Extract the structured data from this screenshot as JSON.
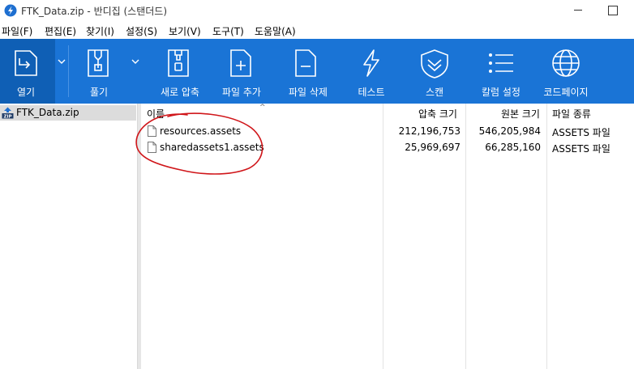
{
  "window": {
    "title": "FTK_Data.zip - 반디집 (스탠더드)"
  },
  "menu": [
    {
      "label": "파일(F)"
    },
    {
      "label": "편집(E)"
    },
    {
      "label": "찾기(I)"
    },
    {
      "label": "설정(S)"
    },
    {
      "label": "보기(V)"
    },
    {
      "label": "도구(T)"
    },
    {
      "label": "도움말(A)"
    }
  ],
  "toolbar": {
    "items": [
      {
        "label": "열기",
        "icon": "open-icon"
      },
      {
        "label": "풀기",
        "icon": "extract-icon"
      },
      {
        "label": "새로 압축",
        "icon": "new-archive-icon"
      },
      {
        "label": "파일 추가",
        "icon": "add-file-icon"
      },
      {
        "label": "파일 삭제",
        "icon": "delete-file-icon"
      },
      {
        "label": "테스트",
        "icon": "test-icon"
      },
      {
        "label": "스캔",
        "icon": "scan-icon"
      },
      {
        "label": "칼럼 설정",
        "icon": "column-settings-icon"
      },
      {
        "label": "코드페이지",
        "icon": "codepage-icon"
      }
    ],
    "colors": {
      "background": "#1a74d6",
      "selected": "#0f5fb5"
    }
  },
  "tree": {
    "root": "FTK_Data.zip"
  },
  "columns": {
    "name": "이름",
    "packed": "압축 크기",
    "original": "원본 크기",
    "type": "파일 종류"
  },
  "files": [
    {
      "name": "resources.assets",
      "packed": "212,196,753",
      "original": "546,205,984",
      "type": "ASSETS 파일"
    },
    {
      "name": "sharedassets1.assets",
      "packed": "25,969,697",
      "original": "66,285,160",
      "type": "ASSETS 파일"
    }
  ],
  "annotation": {
    "color": "#d0161a"
  }
}
